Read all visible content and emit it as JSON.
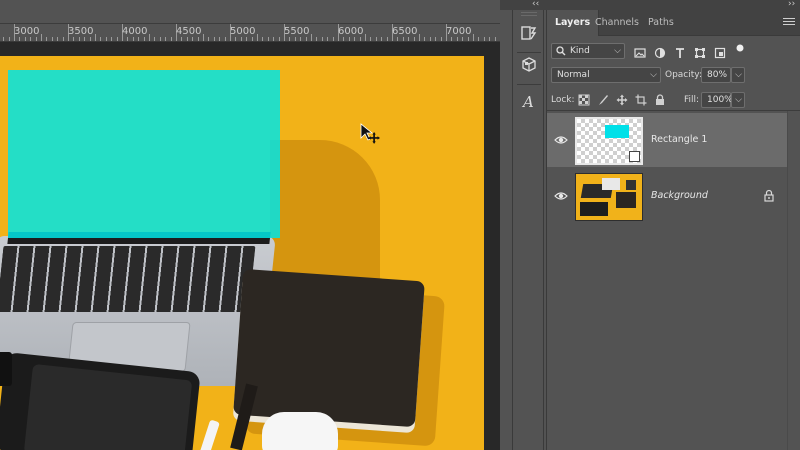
{
  "ruler": {
    "labels": [
      "3000",
      "3500",
      "4000",
      "4500",
      "5000",
      "5500",
      "6000",
      "6500",
      "7000"
    ]
  },
  "layers_panel": {
    "tabs": [
      {
        "label": "Layers",
        "active": true
      },
      {
        "label": "Channels",
        "active": false
      },
      {
        "label": "Paths",
        "active": false
      }
    ],
    "filter": {
      "kind_value": "Kind",
      "icons": [
        "image-filter-icon",
        "adjustment-filter-icon",
        "type-filter-icon",
        "shape-filter-icon",
        "smart-object-filter-icon",
        "filter-toggle-icon"
      ]
    },
    "blend_mode": "Normal",
    "opacity_label": "Opacity:",
    "opacity_value": "80%",
    "lock_label": "Lock:",
    "lock_icons": [
      "lock-transparent-icon",
      "lock-image-icon",
      "lock-position-icon",
      "lock-artboard-icon",
      "lock-all-icon"
    ],
    "fill_label": "Fill:",
    "fill_value": "100%",
    "layers": [
      {
        "name": "Rectangle 1",
        "selected": true,
        "visible": true,
        "locked": false,
        "type": "smart-object"
      },
      {
        "name": "Background",
        "selected": false,
        "visible": true,
        "locked": true,
        "type": "background"
      }
    ]
  },
  "colors": {
    "canvas_bg": "#f2b218",
    "rectangle_fill": "#00e5e5",
    "panel_bg": "#535353",
    "selected_row": "#6b6b6b"
  }
}
